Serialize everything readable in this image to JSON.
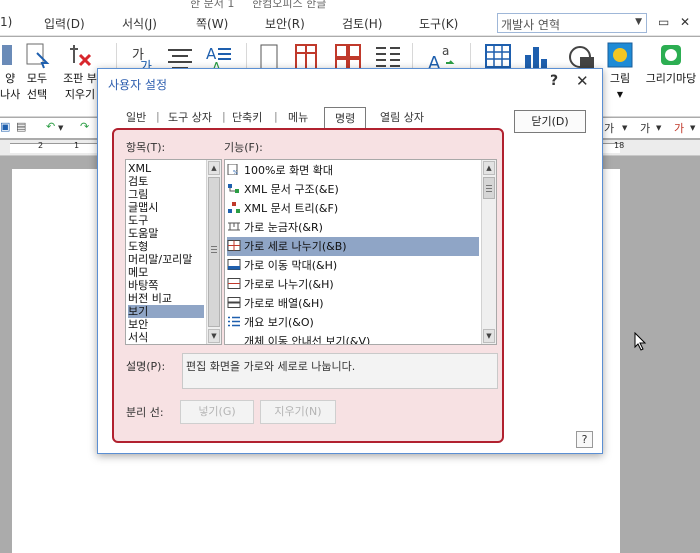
{
  "titlebar": {
    "left_text": "한 문서 1",
    "right_text": "한컴오피스 한글"
  },
  "menubar": {
    "items": [
      "입력(D)",
      "서식(J)",
      "쪽(W)",
      "보안(R)",
      "검토(H)",
      "도구(K)"
    ],
    "partial_left": "1)",
    "search_value": "개발사 연혁"
  },
  "ribbon": {
    "left_labels": {
      "l1a": "양",
      "l1b": "나사",
      "l2a": "모두",
      "l2b": "선택",
      "l3a": "조판 부",
      "l3b": "지우기"
    },
    "right_labels": {
      "picture": "그림",
      "drawing": "그리기마당"
    }
  },
  "toolbar2": {
    "font_a": "가",
    "font_b": "가",
    "font_c": "가"
  },
  "ruler": {
    "num1": "2",
    "num2": "1",
    "num3": "18"
  },
  "dialog": {
    "title": "사용자 설정",
    "help_glyph": "?",
    "close_glyph": "✕",
    "tabs": [
      "일반",
      "도구 상자",
      "단축키",
      "메뉴",
      "명령",
      "열림 상자"
    ],
    "tab_separator": "|",
    "close_button": "닫기(D)",
    "categories_label": "항목(T):",
    "categories": [
      "XML",
      "검토",
      "그림",
      "글맵시",
      "도구",
      "도움말",
      "도형",
      "머리말/꼬리말",
      "메모",
      "바탕쪽",
      "버전 비교",
      "보기",
      "보안",
      "서식"
    ],
    "selected_category": "보기",
    "functions_label": "기능(F):",
    "functions": [
      {
        "label": "100%로 화면 확대",
        "icon": "zoom-100-icon"
      },
      {
        "label": "XML 문서 구조(&E)",
        "icon": "xml-structure-icon"
      },
      {
        "label": "XML 문서 트리(&F)",
        "icon": "xml-tree-icon"
      },
      {
        "label": "가로 눈금자(&R)",
        "icon": "horizontal-ruler-icon"
      },
      {
        "label": "가로 세로 나누기(&B)",
        "icon": "split-both-icon"
      },
      {
        "label": "가로 이동 막대(&H)",
        "icon": "horizontal-scrollbar-icon"
      },
      {
        "label": "가로로 나누기(&H)",
        "icon": "split-horizontal-icon"
      },
      {
        "label": "가로로 배열(&H)",
        "icon": "arrange-horizontal-icon"
      },
      {
        "label": "개요 보기(&O)",
        "icon": "outline-view-icon"
      },
      {
        "label": "개체 이동 안내선 보기(&V)",
        "icon": ""
      }
    ],
    "selected_function": "가로 세로 나누기(&B)",
    "description_label": "설명(P):",
    "description": "편집 화면을 가로와 세로로 나눕니다.",
    "separator_label": "분리 선:",
    "insert_button": "넣기(G)",
    "delete_button": "지우기(N)",
    "bottom_help": "?"
  },
  "colors": {
    "accent_red": "#b1212f",
    "panel_bg": "#f7e1e3",
    "selection": "#8fa5c6",
    "title_blue": "#3060b0"
  }
}
